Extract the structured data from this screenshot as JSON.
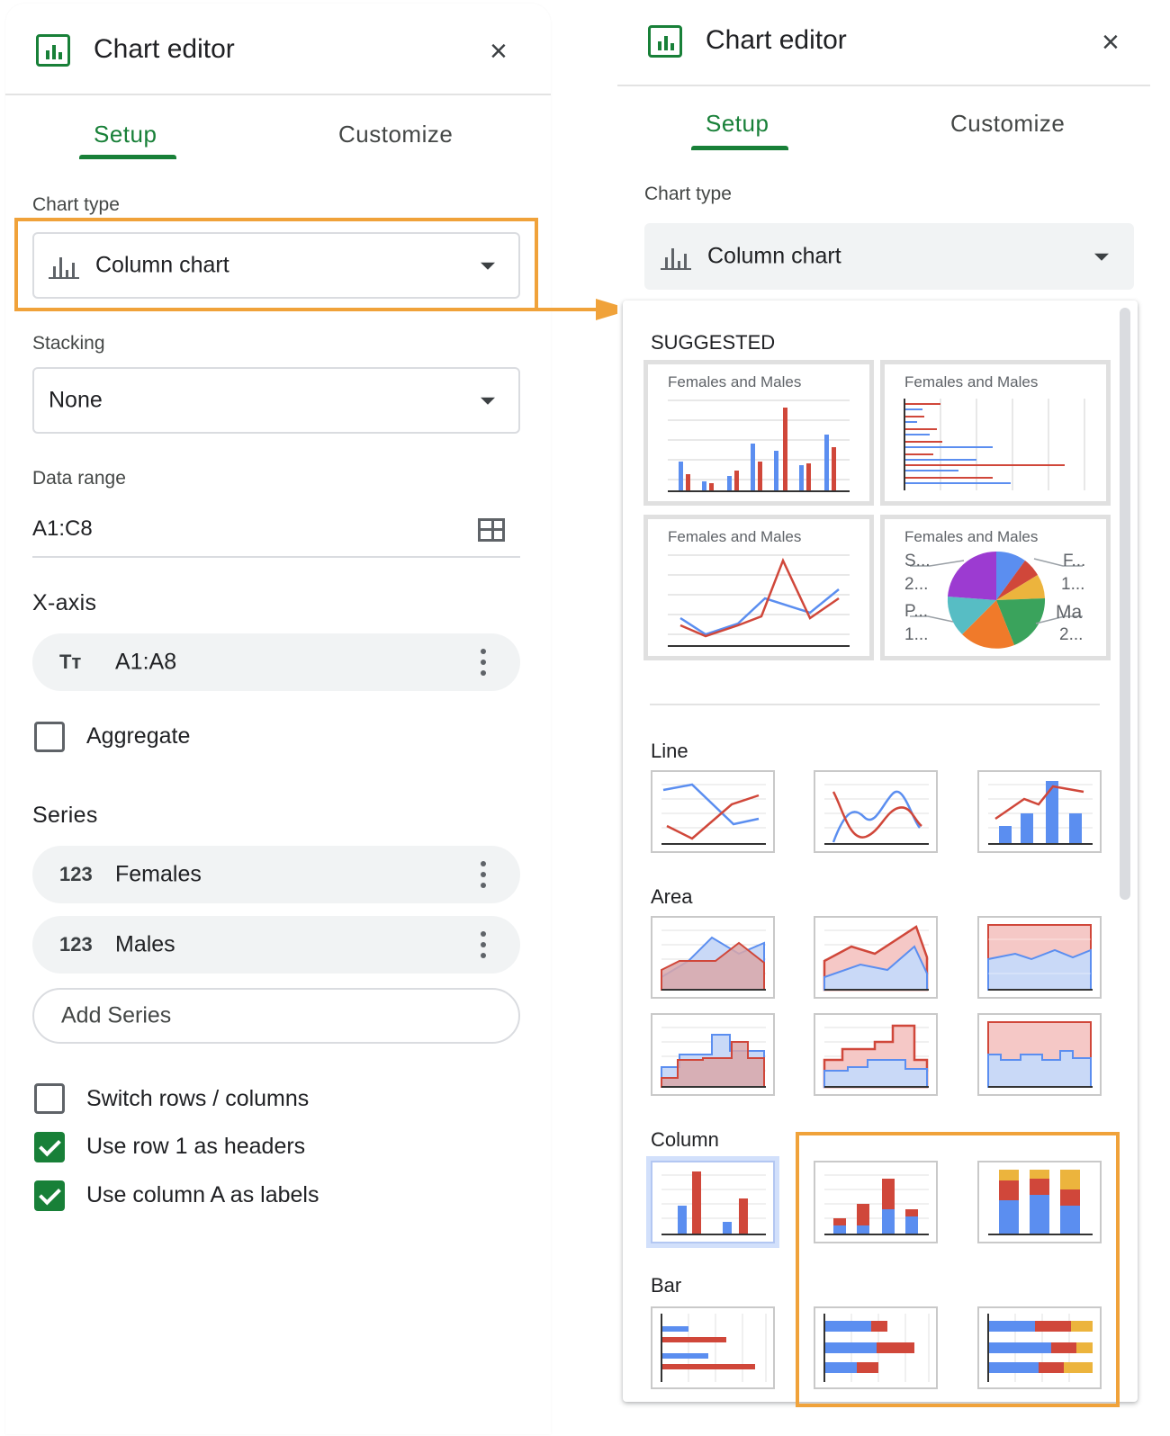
{
  "left_panel": {
    "title": "Chart editor",
    "close": "×",
    "tabs": {
      "setup": "Setup",
      "customize": "Customize"
    },
    "chart_type_label": "Chart type",
    "chart_type_value": "Column chart",
    "stacking_label": "Stacking",
    "stacking_value": "None",
    "data_range_label": "Data range",
    "data_range_value": "A1:C8",
    "x_axis_label": "X-axis",
    "x_axis_icon": "Tт",
    "x_axis_value": "A1:A8",
    "aggregate_label": "Aggregate",
    "series_label": "Series",
    "series": [
      {
        "icon": "123",
        "name": "Females"
      },
      {
        "icon": "123",
        "name": "Males"
      }
    ],
    "add_series": "Add Series",
    "options": [
      {
        "label": "Switch rows / columns",
        "checked": false
      },
      {
        "label": "Use row 1 as headers",
        "checked": true
      },
      {
        "label": "Use column A as labels",
        "checked": true
      }
    ]
  },
  "right_panel": {
    "title": "Chart editor",
    "close": "×",
    "tabs": {
      "setup": "Setup",
      "customize": "Customize"
    },
    "chart_type_label": "Chart type",
    "chart_type_value": "Column chart",
    "menu": {
      "suggested_label": "SUGGESTED",
      "suggested_titles": [
        "Females and Males",
        "Females and Males",
        "Females and Males",
        "Females and Males"
      ],
      "pie_labels": [
        "S...",
        "2...",
        "P...",
        "1...",
        "F...",
        "1...",
        "Ma",
        "2..."
      ],
      "categories": [
        "Line",
        "Area",
        "Column",
        "Bar"
      ]
    }
  },
  "colors": {
    "accent_green": "#188038",
    "highlight_orange": "#f0a23a",
    "series_blue": "#5b8ef0",
    "series_red": "#d0473a",
    "series_yellow": "#ecb43d"
  }
}
